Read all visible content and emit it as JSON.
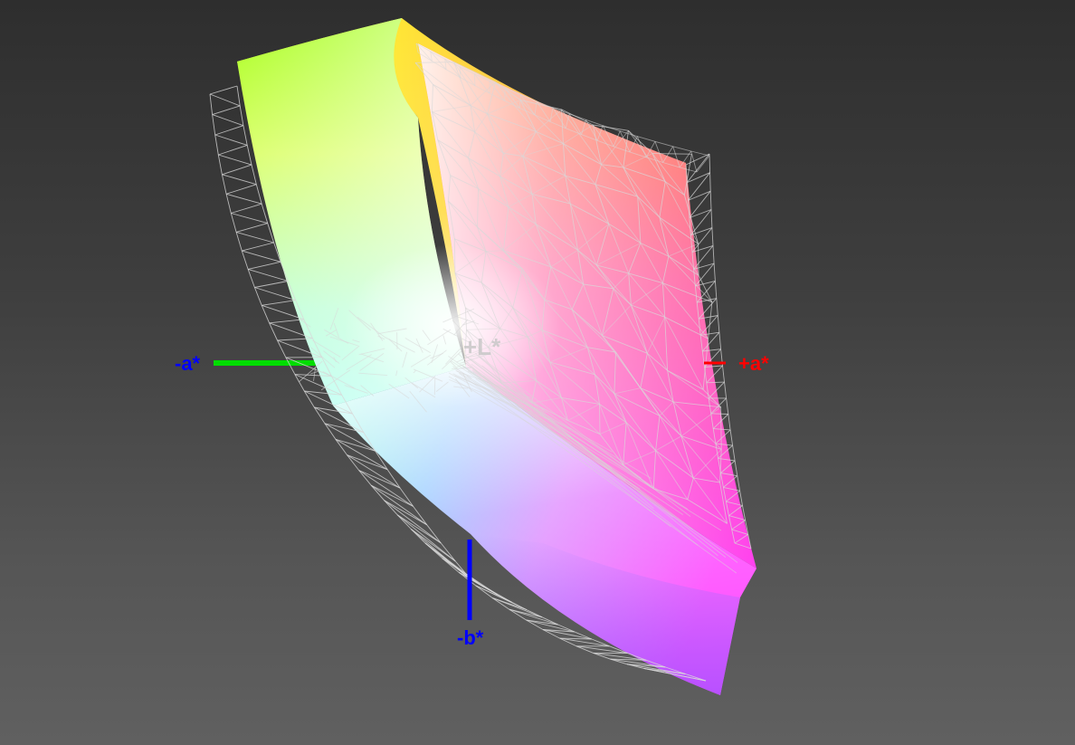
{
  "axes": {
    "neg_a": {
      "label": "-a*",
      "color": "#0000ff",
      "line_color": "#00dd00"
    },
    "pos_a": {
      "label": "+a*",
      "color": "#ff0000",
      "line_color": "#ff0000"
    },
    "neg_b": {
      "label": "-b*",
      "color": "#0000ff",
      "line_color": "#0000ff"
    },
    "pos_l": {
      "label": "+L*",
      "color": "#c8c8c8"
    }
  },
  "colors": {
    "background_top": "#2e2e2e",
    "background_bottom": "#606060",
    "wireframe": "#d8d8d8"
  }
}
